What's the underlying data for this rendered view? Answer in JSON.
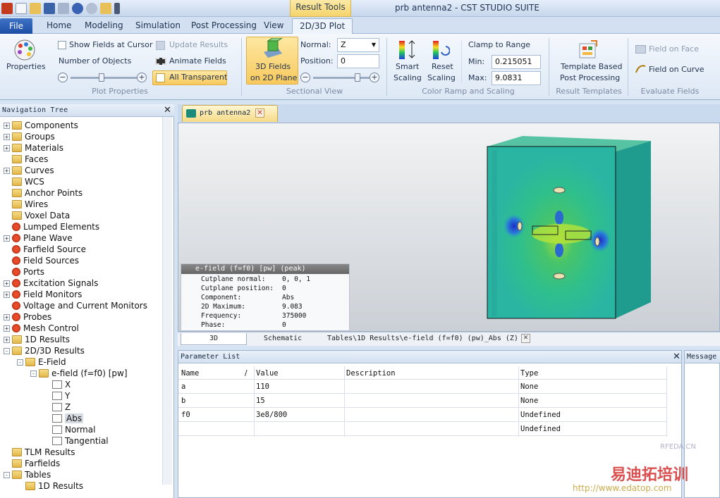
{
  "window": {
    "title": "prb antenna2 - CST STUDIO SUITE",
    "context_tab": "Result Tools"
  },
  "ribbon_tabs": [
    "File",
    "Home",
    "Modeling",
    "Simulation",
    "Post Processing",
    "View",
    "2D/3D Plot"
  ],
  "active_tab": "2D/3D Plot",
  "plot_properties": {
    "properties_label": "Properties",
    "show_fields_at_cursor": "Show Fields at Cursor",
    "number_of_objects": "Number of Objects",
    "update_results": "Update Results",
    "animate_fields": "Animate Fields",
    "all_transparent": "All Transparent",
    "group_label": "Plot Properties"
  },
  "sectional_view": {
    "button_label_1": "3D Fields",
    "button_label_2": "on 2D Plane",
    "normal_label": "Normal:",
    "normal_value": "Z",
    "position_label": "Position:",
    "position_value": "0",
    "group_label": "Sectional View"
  },
  "color_ramp": {
    "smart_scaling_1": "Smart",
    "smart_scaling_2": "Scaling",
    "reset_scaling_1": "Reset",
    "reset_scaling_2": "Scaling",
    "clamp_label": "Clamp to Range",
    "min_label": "Min:",
    "min_value": "0.215051",
    "max_label": "Max:",
    "max_value": "9.0831",
    "group_label": "Color Ramp and Scaling"
  },
  "result_templates": {
    "template_1": "Template Based",
    "template_2": "Post Processing",
    "group_label": "Result Templates"
  },
  "evaluate_fields": {
    "field_on_face": "Field on Face",
    "field_on_curve": "Field on Curve",
    "group_label": "Evaluate Fields"
  },
  "navigation_tree": {
    "title": "Navigation Tree",
    "items": [
      {
        "label": "Components",
        "icon": "folder-icon",
        "expander": "+"
      },
      {
        "label": "Groups",
        "icon": "folder-icon",
        "expander": "+"
      },
      {
        "label": "Materials",
        "icon": "folder-icon",
        "expander": "+"
      },
      {
        "label": "Faces",
        "icon": "folder-icon",
        "expander": ""
      },
      {
        "label": "Curves",
        "icon": "folder-icon",
        "expander": "+"
      },
      {
        "label": "WCS",
        "icon": "folder-icon",
        "expander": ""
      },
      {
        "label": "Anchor Points",
        "icon": "folder-icon",
        "expander": ""
      },
      {
        "label": "Wires",
        "icon": "folder-icon",
        "expander": ""
      },
      {
        "label": "Voxel Data",
        "icon": "folder-icon",
        "expander": ""
      },
      {
        "label": "Lumped Elements",
        "icon": "red-gear-icon",
        "expander": ""
      },
      {
        "label": "Plane Wave",
        "icon": "red-gear-icon",
        "expander": "+"
      },
      {
        "label": "Farfield Source",
        "icon": "red-gear-icon",
        "expander": ""
      },
      {
        "label": "Field Sources",
        "icon": "red-gear-icon",
        "expander": ""
      },
      {
        "label": "Ports",
        "icon": "red-gear-icon",
        "expander": ""
      },
      {
        "label": "Excitation Signals",
        "icon": "red-gear-icon",
        "expander": "+"
      },
      {
        "label": "Field Monitors",
        "icon": "red-gear-icon",
        "expander": "+"
      },
      {
        "label": "Voltage and Current Monitors",
        "icon": "red-gear-icon",
        "expander": ""
      },
      {
        "label": "Probes",
        "icon": "red-gear-icon",
        "expander": "+"
      },
      {
        "label": "Mesh Control",
        "icon": "red-gear-icon",
        "expander": "+"
      },
      {
        "label": "1D Results",
        "icon": "folder-icon",
        "expander": "+"
      },
      {
        "label": "2D/3D Results",
        "icon": "folder-icon",
        "expander": "-"
      },
      {
        "label": "E-Field",
        "icon": "folder-icon",
        "expander": "-"
      },
      {
        "label": "e-field (f=f0) [pw]",
        "icon": "folder-icon",
        "expander": "-"
      },
      {
        "label": "X",
        "icon": "field-icon",
        "expander": ""
      },
      {
        "label": "Y",
        "icon": "field-icon",
        "expander": ""
      },
      {
        "label": "Z",
        "icon": "field-icon",
        "expander": ""
      },
      {
        "label": "Abs",
        "icon": "field-icon",
        "expander": ""
      },
      {
        "label": "Normal",
        "icon": "field-icon",
        "expander": ""
      },
      {
        "label": "Tangential",
        "icon": "field-icon",
        "expander": ""
      },
      {
        "label": "TLM Results",
        "icon": "folder-icon",
        "expander": ""
      },
      {
        "label": "Farfields",
        "icon": "folder-icon",
        "expander": ""
      },
      {
        "label": "Tables",
        "icon": "folder-icon",
        "expander": "-"
      },
      {
        "label": "1D Results",
        "icon": "folder-icon",
        "expander": ""
      }
    ]
  },
  "document": {
    "tab_label": "prb antenna2",
    "info_title": "e-field (f=f0) [pw] (peak)",
    "info_lines": [
      {
        "key": "Cutplane normal:",
        "value": "0, 0, 1"
      },
      {
        "key": "Cutplane position:",
        "value": "0"
      },
      {
        "key": "Component:",
        "value": "Abs"
      },
      {
        "key": "2D Maximum:",
        "value": "9.083"
      },
      {
        "key": "Frequency:",
        "value": "375000"
      },
      {
        "key": "Phase:",
        "value": "0"
      }
    ],
    "view_tabs": [
      "3D",
      "Schematic",
      "Tables\\1D Results\\e-field (f=f0) (pw)_Abs (Z)"
    ]
  },
  "parameter_list": {
    "title": "Parameter List",
    "columns": [
      "Name",
      "Value",
      "Description",
      "Type"
    ],
    "rows": [
      {
        "name": "a",
        "value": "110",
        "description": "",
        "type": "None"
      },
      {
        "name": "b",
        "value": "15",
        "description": "",
        "type": "None"
      },
      {
        "name": "f0",
        "value": "3e8/800",
        "description": "",
        "type": "Undefined"
      },
      {
        "name": "",
        "value": "",
        "description": "",
        "type": "Undefined"
      }
    ]
  },
  "messages": {
    "title": "Message"
  },
  "watermark": {
    "rfeda": "RFEDA.CN",
    "brand": "易迪拓培训",
    "url": "http://www.edatop.com"
  },
  "colors": {
    "accent": "#f8c95d",
    "file_tab": "#1d4ea4",
    "field_green": "#2fbf72",
    "field_blue": "#1f4fd6"
  }
}
